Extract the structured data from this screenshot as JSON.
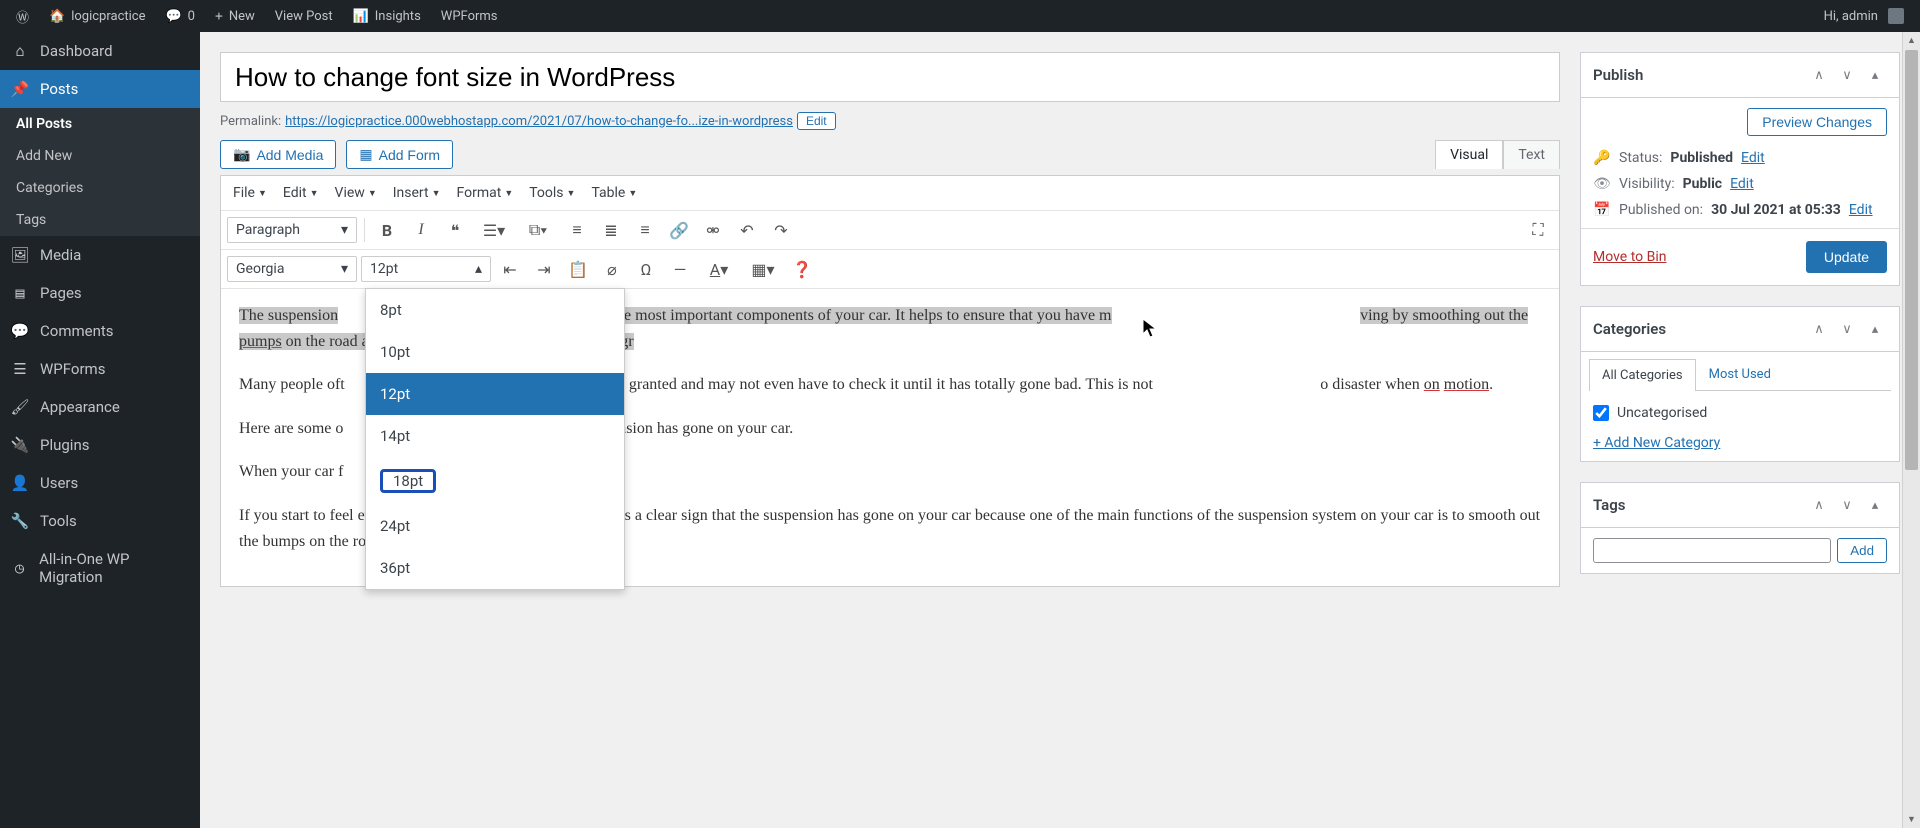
{
  "admin_bar": {
    "site": "logicpractice",
    "comments": "0",
    "new": "New",
    "view_post": "View Post",
    "insights": "Insights",
    "wpforms": "WPForms",
    "greeting": "Hi, admin"
  },
  "menu": {
    "dashboard": "Dashboard",
    "posts": "Posts",
    "posts_sub": {
      "all": "All Posts",
      "add": "Add New",
      "cat": "Categories",
      "tags": "Tags"
    },
    "media": "Media",
    "pages": "Pages",
    "comments": "Comments",
    "wpforms": "WPForms",
    "appearance": "Appearance",
    "plugins": "Plugins",
    "users": "Users",
    "tools": "Tools",
    "aio": "All-in-One WP Migration"
  },
  "editor": {
    "title_value": "How to change font size in WordPress",
    "permalink_label": "Permalink:",
    "permalink_url": "https://logicpractice.000webhostapp.com/2021/07/how-to-change-fo...ize-in-wordpress",
    "permalink_edit": "Edit",
    "add_media": "Add Media",
    "add_form": "Add Form",
    "tab_visual": "Visual",
    "tab_text": "Text",
    "menubar": {
      "file": "File",
      "edit": "Edit",
      "view": "View",
      "insert": "Insert",
      "format": "Format",
      "tools": "Tools",
      "table": "Table"
    },
    "format_dropdown": "Paragraph",
    "font_dropdown": "Georgia",
    "size_dropdown": "12pt",
    "font_sizes": [
      "8pt",
      "10pt",
      "12pt",
      "14pt",
      "18pt",
      "24pt",
      "36pt"
    ],
    "content": {
      "p1a": "The suspension",
      "p1b": "s) is one of the most important components of your car. It helps to ensure that you have m",
      "p1c": "ving by smoothing out the ",
      "p1d": "pumps",
      "p1e": " on the road and also by balancing the wheels on the gr",
      "p2a": "Many people oft",
      "p2b": "stem for granted and may not even have to check it until it has totally gone bad. This is not ",
      "p2c": "o disaster when ",
      "p2d": "on",
      "p2e": " ",
      "p2f": "motion",
      "p2g": ".",
      "p3a": "Here are some o",
      "p3b": "he suspension has gone on your car.",
      "p4": "When your car f",
      "p5": "If you start to feel every bump on the road while driving, it is a clear sign that the suspension has gone on your car because one of the main functions of the suspension system on your car is to smooth out the bumps on the road."
    }
  },
  "publish": {
    "title": "Publish",
    "preview": "Preview Changes",
    "status_label": "Status:",
    "status_value": "Published",
    "visibility_label": "Visibility:",
    "visibility_value": "Public",
    "published_label": "Published on:",
    "published_value": "30 Jul 2021 at 05:33",
    "edit": "Edit",
    "move_bin": "Move to Bin",
    "update": "Update"
  },
  "categories": {
    "title": "Categories",
    "tab_all": "All Categories",
    "tab_most": "Most Used",
    "uncategorised": "Uncategorised",
    "add_new": "+ Add New Category"
  },
  "tags": {
    "title": "Tags",
    "add": "Add"
  }
}
